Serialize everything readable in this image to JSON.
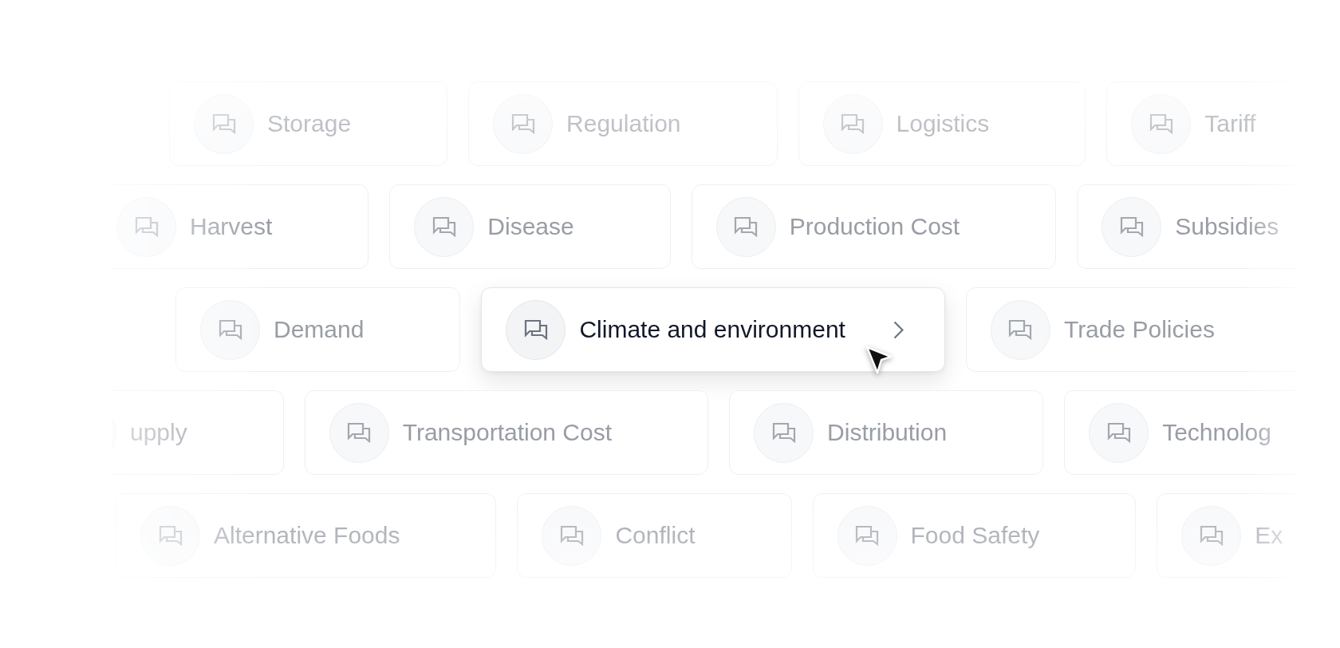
{
  "rows": [
    {
      "cards": [
        {
          "label": "Storage",
          "selected": false
        },
        {
          "label": "Regulation",
          "selected": false
        },
        {
          "label": "Logistics",
          "selected": false
        },
        {
          "label": "Tariff",
          "selected": false
        }
      ]
    },
    {
      "cards": [
        {
          "label": "Harvest",
          "selected": false
        },
        {
          "label": "Disease",
          "selected": false
        },
        {
          "label": "Production Cost",
          "selected": false
        },
        {
          "label": "Subsidies",
          "selected": false
        }
      ]
    },
    {
      "cards": [
        {
          "label": "Demand",
          "selected": false
        },
        {
          "label": "Climate and environment",
          "selected": true
        },
        {
          "label": "Trade Policies",
          "selected": false
        }
      ]
    },
    {
      "cards": [
        {
          "label": "upply",
          "selected": false
        },
        {
          "label": "Transportation Cost",
          "selected": false
        },
        {
          "label": "Distribution",
          "selected": false
        },
        {
          "label": "Technolog",
          "selected": false
        }
      ]
    },
    {
      "cards": [
        {
          "label": "Alternative Foods",
          "selected": false
        },
        {
          "label": "Conflict",
          "selected": false
        },
        {
          "label": "Food Safety",
          "selected": false
        },
        {
          "label": "Ex",
          "selected": false
        }
      ]
    }
  ]
}
